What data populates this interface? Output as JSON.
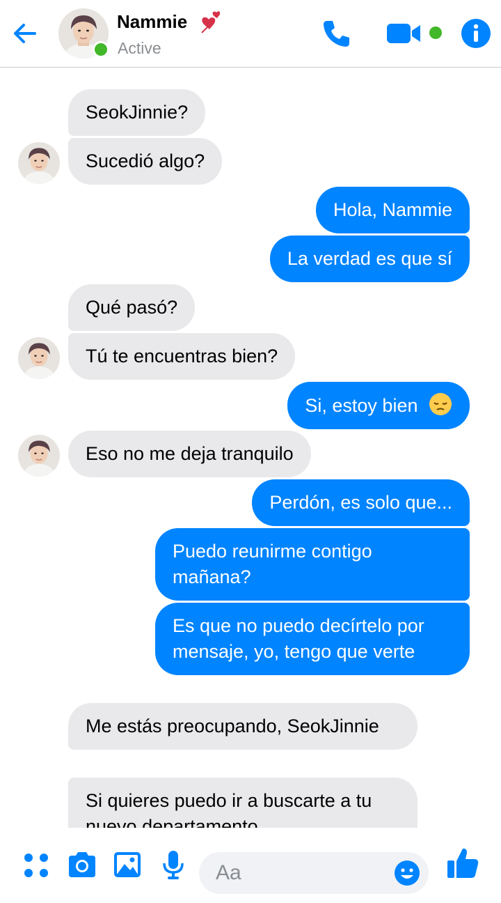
{
  "header": {
    "name": "Nammie",
    "status": "Active",
    "heart_emoji": "two-hearts",
    "accent_color": "#0084ff",
    "online_color": "#42b72a"
  },
  "messages": [
    {
      "from": "contact",
      "text": "SeokJinnie?"
    },
    {
      "from": "contact",
      "text": "Sucedió algo?"
    },
    {
      "from": "me",
      "text": "Hola, Nammie"
    },
    {
      "from": "me",
      "text": "La verdad es que sí"
    },
    {
      "from": "contact",
      "text": "Qué pasó?"
    },
    {
      "from": "contact",
      "text": "Tú te encuentras bien?"
    },
    {
      "from": "me",
      "text": "Si, estoy bien"
    },
    {
      "from": "contact",
      "text": "Eso no me deja tranquilo"
    },
    {
      "from": "me",
      "text": "Perdón, es solo que..."
    },
    {
      "from": "me",
      "text": "Puedo reunirme contigo mañana?"
    },
    {
      "from": "me",
      "text": "Es que no puedo decírtelo por mensaje, yo, tengo que verte"
    },
    {
      "from": "contact",
      "text": "Me estás preocupando, SeokJinnie"
    },
    {
      "from": "contact",
      "text": "Si quieres puedo ir a buscarte a tu nuevo departamento"
    }
  ],
  "composer": {
    "placeholder": "Aa",
    "icons": [
      "menu-dots-icon",
      "camera-icon",
      "image-icon",
      "microphone-icon",
      "emoji-icon",
      "thumbs-up-icon"
    ]
  },
  "colors": {
    "outgoing_bubble": "#0084ff",
    "incoming_bubble": "#e9e9eb"
  }
}
